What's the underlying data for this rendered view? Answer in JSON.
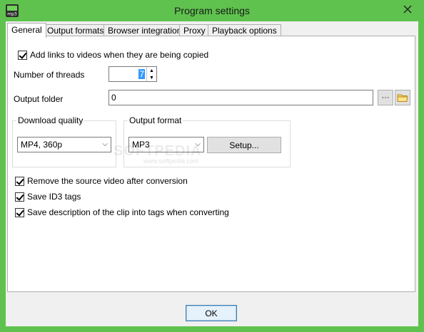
{
  "window": {
    "title": "Program settings",
    "icon_text": "mp3",
    "colors": {
      "frame": "#5fc24e",
      "client": "#f0f0f0",
      "selection": "#3399ff"
    }
  },
  "tabs": [
    {
      "label": "General",
      "active": true
    },
    {
      "label": "Output formats",
      "active": false
    },
    {
      "label": "Browser integration",
      "active": false
    },
    {
      "label": "Proxy",
      "active": false
    },
    {
      "label": "Playback options",
      "active": false
    }
  ],
  "general": {
    "add_links_checkbox": {
      "label": "Add links to videos when they are being copied",
      "checked": true
    },
    "threads": {
      "label": "Number of threads",
      "value": "7"
    },
    "output_folder": {
      "label": "Output folder",
      "value": "0",
      "browse_label": "···",
      "folder_icon": "folder-icon"
    },
    "download_quality": {
      "label": "Download quality",
      "selected": "MP4, 360p"
    },
    "output_format": {
      "label": "Output format",
      "selected": "MP3",
      "setup_label": "Setup..."
    },
    "remove_source_checkbox": {
      "label": "Remove the source video after conversion",
      "checked": true
    },
    "save_id3_checkbox": {
      "label": "Save ID3 tags",
      "checked": true
    },
    "save_description_checkbox": {
      "label": "Save description of the clip into tags when converting",
      "checked": true
    }
  },
  "footer": {
    "ok_label": "OK"
  },
  "watermark": {
    "main": "SOFTPEDIA",
    "sub": "www.softpedia.com"
  }
}
